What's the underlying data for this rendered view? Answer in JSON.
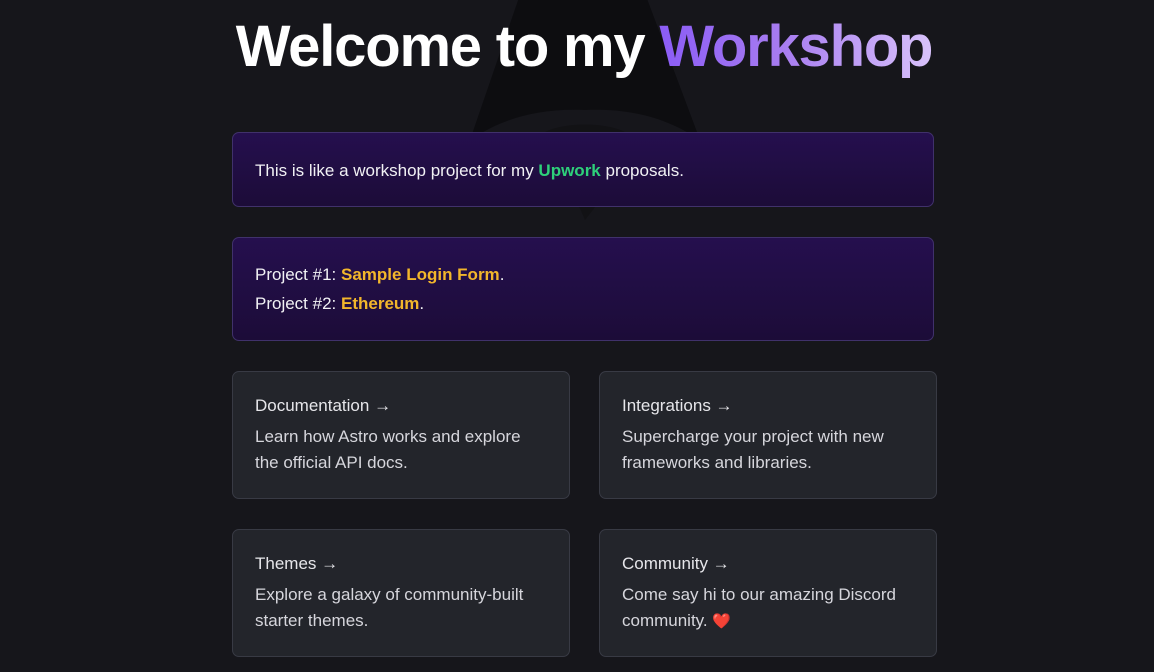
{
  "header": {
    "title_prefix": "Welcome to my ",
    "title_accent": "Workshop"
  },
  "intro": {
    "before": "This is like a workshop project for my ",
    "link": "Upwork",
    "after": " proposals."
  },
  "projects": [
    {
      "label": "Project #1: ",
      "link": "Sample Login Form",
      "after": "."
    },
    {
      "label": "Project #2: ",
      "link": "Ethereum",
      "after": "."
    }
  ],
  "cards": [
    {
      "title": "Documentation →",
      "description": "Learn how Astro works and explore the official API docs."
    },
    {
      "title": "Integrations →",
      "description": "Supercharge your project with new frameworks and libraries."
    },
    {
      "title": "Themes →",
      "description": "Explore a galaxy of community-built starter themes."
    },
    {
      "title": "Community →",
      "description": "Come say hi to our amazing Discord community.",
      "emoji": "❤️"
    }
  ],
  "colors": {
    "background": "#16161b",
    "accent_purple": "#8b5cf6",
    "link_green": "#2ed07a",
    "link_gold": "#f2b62b",
    "card_background": "#23252b",
    "instructions_background": "#250f4e"
  },
  "background_icon": "astro-logo-icon"
}
